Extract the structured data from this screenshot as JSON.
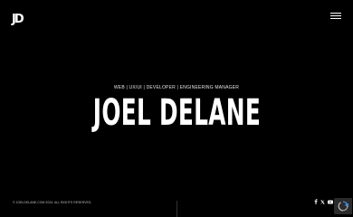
{
  "header": {
    "logo_text": "JD",
    "menu_icon": "hamburger-menu-icon"
  },
  "hero": {
    "subtitle": "WEB | UX/UI | DEVELOPER | ENGINEERING MANAGER",
    "name": "JOEL DELANE"
  },
  "footer": {
    "copyright": "© JOELDELANE.COM 2024. ALL RIGHTS RESERVED.",
    "social_icons": [
      "facebook-icon",
      "twitter-icon",
      "youtube-icon",
      "instagram-icon"
    ]
  },
  "recaptcha": {
    "icon": "recaptcha-icon"
  }
}
